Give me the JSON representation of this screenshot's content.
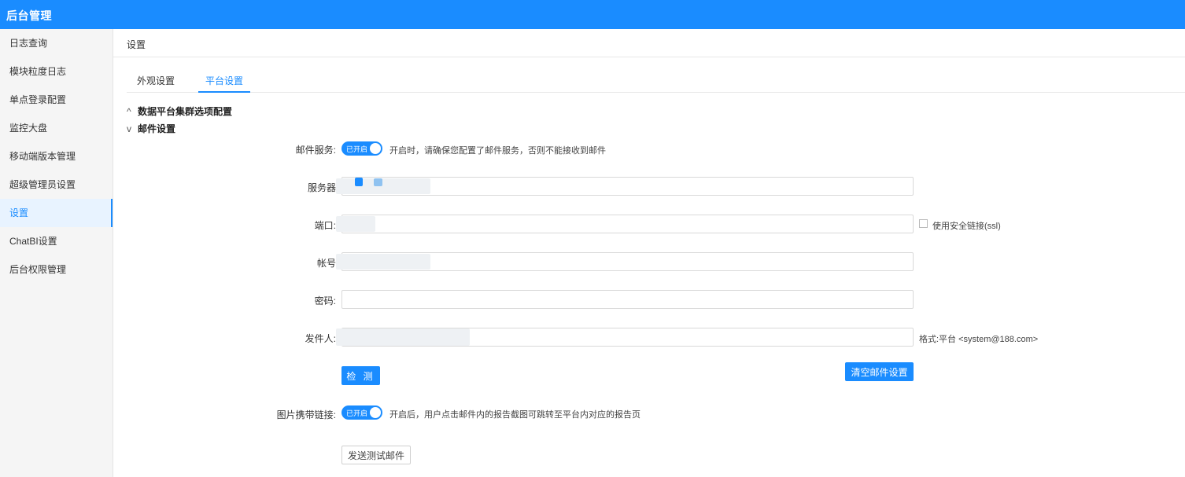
{
  "app": {
    "title": "后台管理"
  },
  "sidebar": {
    "items": [
      {
        "label": "日志查询"
      },
      {
        "label": "模块粒度日志"
      },
      {
        "label": "单点登录配置"
      },
      {
        "label": "监控大盘"
      },
      {
        "label": "移动端版本管理"
      },
      {
        "label": "超级管理员设置"
      },
      {
        "label": "设置",
        "active": true
      },
      {
        "label": "ChatBI设置"
      },
      {
        "label": "后台权限管理"
      }
    ]
  },
  "page": {
    "title": "设置"
  },
  "tabs": [
    {
      "label": "外观设置"
    },
    {
      "label": "平台设置",
      "active": true
    }
  ],
  "sections": {
    "cluster": {
      "label": "数据平台集群选项配置",
      "chevron": "^"
    },
    "mail": {
      "label": "邮件设置",
      "chevron": "v"
    }
  },
  "form": {
    "mail_service": {
      "label": "邮件服务:",
      "switch_text": "已开启",
      "hint": "开启时，请确保您配置了邮件服务，否则不能接收到邮件"
    },
    "server": {
      "label": "服务器",
      "value": ""
    },
    "port": {
      "label": "端口:",
      "value": ""
    },
    "ssl": {
      "label": "使用安全链接(ssl)",
      "checked": false
    },
    "account": {
      "label": "帐号",
      "value": ""
    },
    "password": {
      "label": "密码:",
      "value": ""
    },
    "sender": {
      "label": "发件人:",
      "value": "",
      "format_note": "格式:平台 <system@188.com>"
    },
    "detect_button": "检 测",
    "clear_button": "清空邮件设置",
    "image_link": {
      "label": "图片携带链接:",
      "switch_text": "已开启",
      "hint": "开启后，用户点击邮件内的报告截图可跳转至平台内对应的报告页"
    },
    "send_test_button": "发送测试邮件"
  },
  "colors": {
    "accent": "#1a8cff",
    "sidebar_bg": "#f5f5f5",
    "active_item_bg": "#e8f3ff"
  }
}
